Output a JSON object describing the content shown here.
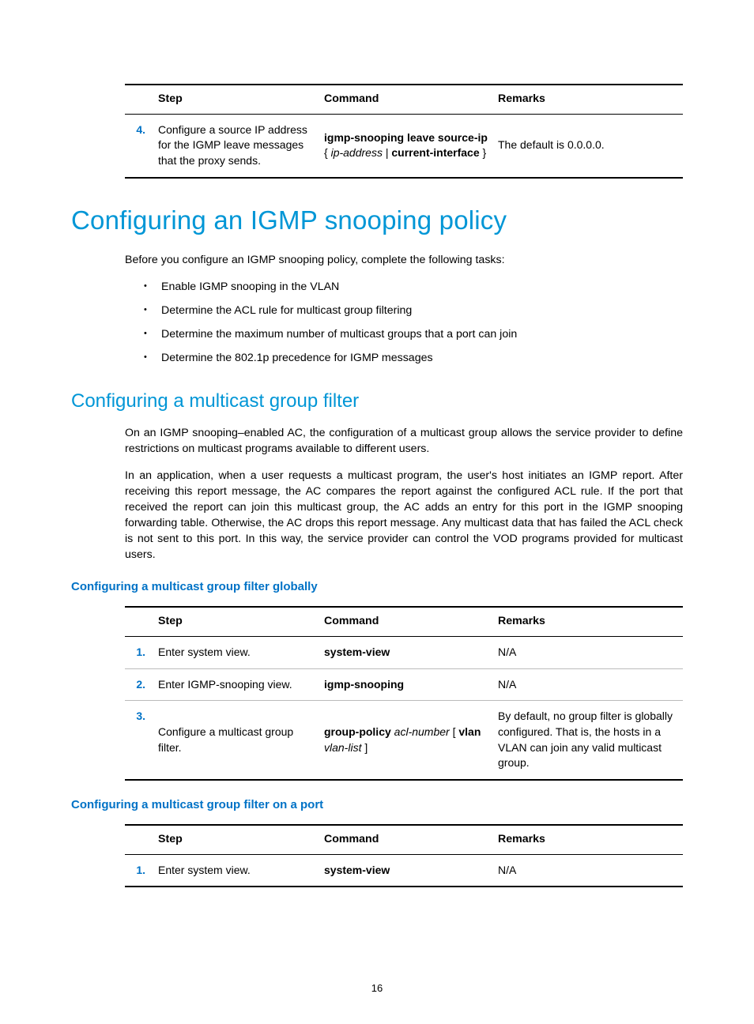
{
  "table1": {
    "headers": {
      "step": "Step",
      "command": "Command",
      "remarks": "Remarks"
    },
    "rows": [
      {
        "num": "4.",
        "step": "Configure a source IP address for the IGMP leave messages  that the proxy sends.",
        "cmd_parts": [
          {
            "t": "igmp-snooping leave source-ip",
            "s": "b"
          },
          {
            "t": " ",
            "s": ""
          },
          {
            "t": "{ ",
            "s": ""
          },
          {
            "t": "ip-address",
            "s": "i"
          },
          {
            "t": " | ",
            "s": ""
          },
          {
            "t": "current-interface",
            "s": "b"
          },
          {
            "t": " }",
            "s": ""
          }
        ],
        "remarks": "The default is 0.0.0.0."
      }
    ]
  },
  "h1": "Configuring an IGMP snooping policy",
  "intro": "Before you configure an IGMP snooping policy, complete the following tasks:",
  "bullets": [
    "Enable IGMP snooping in the VLAN",
    "Determine the ACL rule for multicast group filtering",
    "Determine the maximum number of multicast groups that a port can join",
    "Determine the 802.1p precedence for IGMP messages"
  ],
  "h2": "Configuring a multicast group filter",
  "para1": "On an IGMP snooping–enabled AC, the configuration of a multicast group allows the service provider to define restrictions on multicast programs available to different users.",
  "para2": "In an application, when a user requests a multicast program, the user's host initiates an IGMP report. After receiving this report message, the AC compares the report against the configured ACL rule. If the port that received the report can join this multicast group, the AC adds an entry for this port in the IGMP snooping forwarding table. Otherwise, the AC drops this report message. Any multicast data that has failed the ACL check is not sent to this port. In this way, the service provider can control the VOD programs provided for multicast users.",
  "h3a": "Configuring a multicast group filter globally",
  "table2": {
    "headers": {
      "step": "Step",
      "command": "Command",
      "remarks": "Remarks"
    },
    "rows": [
      {
        "num": "1.",
        "step": "Enter system view.",
        "cmd_parts": [
          {
            "t": "system-view",
            "s": "b"
          }
        ],
        "remarks": "N/A"
      },
      {
        "num": "2.",
        "step": "Enter IGMP-snooping view.",
        "cmd_parts": [
          {
            "t": "igmp-snooping",
            "s": "b"
          }
        ],
        "remarks": "N/A"
      },
      {
        "num": "3.",
        "step": "Configure a multicast group filter.",
        "cmd_parts": [
          {
            "t": "group-policy",
            "s": "b"
          },
          {
            "t": " ",
            "s": ""
          },
          {
            "t": "acl-number",
            "s": "i"
          },
          {
            "t": " [ ",
            "s": ""
          },
          {
            "t": "vlan",
            "s": "b"
          },
          {
            "t": " ",
            "s": ""
          },
          {
            "t": "vlan-list",
            "s": "i"
          },
          {
            "t": " ]",
            "s": ""
          }
        ],
        "remarks": "By default, no group filter is globally configured. That is, the hosts in a VLAN can join any valid multicast group."
      }
    ]
  },
  "h3b": "Configuring a multicast group filter on a port",
  "table3": {
    "headers": {
      "step": "Step",
      "command": "Command",
      "remarks": "Remarks"
    },
    "rows": [
      {
        "num": "1.",
        "step": "Enter system view.",
        "cmd_parts": [
          {
            "t": "system-view",
            "s": "b"
          }
        ],
        "remarks": "N/A"
      }
    ]
  },
  "page_number": "16"
}
